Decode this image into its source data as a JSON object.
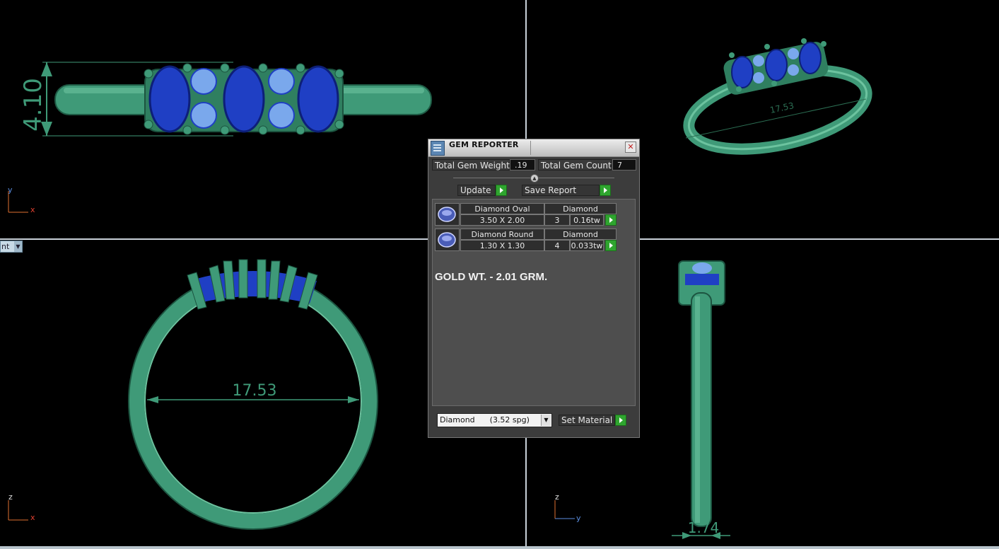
{
  "dialog": {
    "title": "GEM REPORTER",
    "close_glyph": "✕",
    "total_weight_label": "Total Gem Weight",
    "total_weight_value": ".19",
    "total_count_label": "Total Gem Count",
    "total_count_value": "7",
    "update_label": "Update",
    "save_label": "Save Report",
    "gems": [
      {
        "name": "Diamond Oval",
        "material": "Diamond",
        "size": "3.50 X 2.00",
        "count": "3",
        "weight": "0.16tw"
      },
      {
        "name": "Diamond Round",
        "material": "Diamond",
        "size": "1.30 X 1.30",
        "count": "4",
        "weight": "0.033tw"
      }
    ],
    "note": "GOLD WT. - 2.01 GRM.",
    "material_select": "Diamond      (3.52 spg)",
    "set_material_label": "Set Material"
  },
  "viewports": {
    "top_left": {
      "axis_v": "y",
      "axis_h": "x",
      "dimension": "4.10"
    },
    "top_right": {
      "dimension": "17.53"
    },
    "bottom_left": {
      "axis_v": "z",
      "axis_h": "x",
      "dimension": "17.53"
    },
    "bottom_right": {
      "axis_v": "z",
      "axis_h": "y",
      "dimension": "1.74"
    },
    "view_dropdown": "nt"
  },
  "colors": {
    "ring_green": "#3f9a78",
    "gem_blue": "#1f3fc4",
    "accent_green": "#2fa52f"
  }
}
